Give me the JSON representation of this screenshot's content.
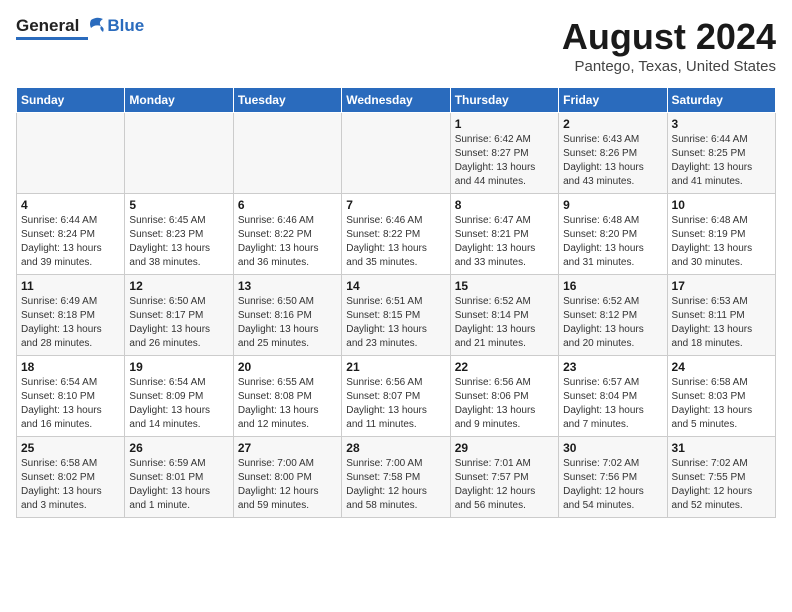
{
  "header": {
    "logo_general": "General",
    "logo_blue": "Blue",
    "main_title": "August 2024",
    "sub_title": "Pantego, Texas, United States"
  },
  "calendar": {
    "days_of_week": [
      "Sunday",
      "Monday",
      "Tuesday",
      "Wednesday",
      "Thursday",
      "Friday",
      "Saturday"
    ],
    "weeks": [
      [
        {
          "day": "",
          "info": ""
        },
        {
          "day": "",
          "info": ""
        },
        {
          "day": "",
          "info": ""
        },
        {
          "day": "",
          "info": ""
        },
        {
          "day": "1",
          "info": "Sunrise: 6:42 AM\nSunset: 8:27 PM\nDaylight: 13 hours\nand 44 minutes."
        },
        {
          "day": "2",
          "info": "Sunrise: 6:43 AM\nSunset: 8:26 PM\nDaylight: 13 hours\nand 43 minutes."
        },
        {
          "day": "3",
          "info": "Sunrise: 6:44 AM\nSunset: 8:25 PM\nDaylight: 13 hours\nand 41 minutes."
        }
      ],
      [
        {
          "day": "4",
          "info": "Sunrise: 6:44 AM\nSunset: 8:24 PM\nDaylight: 13 hours\nand 39 minutes."
        },
        {
          "day": "5",
          "info": "Sunrise: 6:45 AM\nSunset: 8:23 PM\nDaylight: 13 hours\nand 38 minutes."
        },
        {
          "day": "6",
          "info": "Sunrise: 6:46 AM\nSunset: 8:22 PM\nDaylight: 13 hours\nand 36 minutes."
        },
        {
          "day": "7",
          "info": "Sunrise: 6:46 AM\nSunset: 8:22 PM\nDaylight: 13 hours\nand 35 minutes."
        },
        {
          "day": "8",
          "info": "Sunrise: 6:47 AM\nSunset: 8:21 PM\nDaylight: 13 hours\nand 33 minutes."
        },
        {
          "day": "9",
          "info": "Sunrise: 6:48 AM\nSunset: 8:20 PM\nDaylight: 13 hours\nand 31 minutes."
        },
        {
          "day": "10",
          "info": "Sunrise: 6:48 AM\nSunset: 8:19 PM\nDaylight: 13 hours\nand 30 minutes."
        }
      ],
      [
        {
          "day": "11",
          "info": "Sunrise: 6:49 AM\nSunset: 8:18 PM\nDaylight: 13 hours\nand 28 minutes."
        },
        {
          "day": "12",
          "info": "Sunrise: 6:50 AM\nSunset: 8:17 PM\nDaylight: 13 hours\nand 26 minutes."
        },
        {
          "day": "13",
          "info": "Sunrise: 6:50 AM\nSunset: 8:16 PM\nDaylight: 13 hours\nand 25 minutes."
        },
        {
          "day": "14",
          "info": "Sunrise: 6:51 AM\nSunset: 8:15 PM\nDaylight: 13 hours\nand 23 minutes."
        },
        {
          "day": "15",
          "info": "Sunrise: 6:52 AM\nSunset: 8:14 PM\nDaylight: 13 hours\nand 21 minutes."
        },
        {
          "day": "16",
          "info": "Sunrise: 6:52 AM\nSunset: 8:12 PM\nDaylight: 13 hours\nand 20 minutes."
        },
        {
          "day": "17",
          "info": "Sunrise: 6:53 AM\nSunset: 8:11 PM\nDaylight: 13 hours\nand 18 minutes."
        }
      ],
      [
        {
          "day": "18",
          "info": "Sunrise: 6:54 AM\nSunset: 8:10 PM\nDaylight: 13 hours\nand 16 minutes."
        },
        {
          "day": "19",
          "info": "Sunrise: 6:54 AM\nSunset: 8:09 PM\nDaylight: 13 hours\nand 14 minutes."
        },
        {
          "day": "20",
          "info": "Sunrise: 6:55 AM\nSunset: 8:08 PM\nDaylight: 13 hours\nand 12 minutes."
        },
        {
          "day": "21",
          "info": "Sunrise: 6:56 AM\nSunset: 8:07 PM\nDaylight: 13 hours\nand 11 minutes."
        },
        {
          "day": "22",
          "info": "Sunrise: 6:56 AM\nSunset: 8:06 PM\nDaylight: 13 hours\nand 9 minutes."
        },
        {
          "day": "23",
          "info": "Sunrise: 6:57 AM\nSunset: 8:04 PM\nDaylight: 13 hours\nand 7 minutes."
        },
        {
          "day": "24",
          "info": "Sunrise: 6:58 AM\nSunset: 8:03 PM\nDaylight: 13 hours\nand 5 minutes."
        }
      ],
      [
        {
          "day": "25",
          "info": "Sunrise: 6:58 AM\nSunset: 8:02 PM\nDaylight: 13 hours\nand 3 minutes."
        },
        {
          "day": "26",
          "info": "Sunrise: 6:59 AM\nSunset: 8:01 PM\nDaylight: 13 hours\nand 1 minute."
        },
        {
          "day": "27",
          "info": "Sunrise: 7:00 AM\nSunset: 8:00 PM\nDaylight: 12 hours\nand 59 minutes."
        },
        {
          "day": "28",
          "info": "Sunrise: 7:00 AM\nSunset: 7:58 PM\nDaylight: 12 hours\nand 58 minutes."
        },
        {
          "day": "29",
          "info": "Sunrise: 7:01 AM\nSunset: 7:57 PM\nDaylight: 12 hours\nand 56 minutes."
        },
        {
          "day": "30",
          "info": "Sunrise: 7:02 AM\nSunset: 7:56 PM\nDaylight: 12 hours\nand 54 minutes."
        },
        {
          "day": "31",
          "info": "Sunrise: 7:02 AM\nSunset: 7:55 PM\nDaylight: 12 hours\nand 52 minutes."
        }
      ]
    ]
  }
}
